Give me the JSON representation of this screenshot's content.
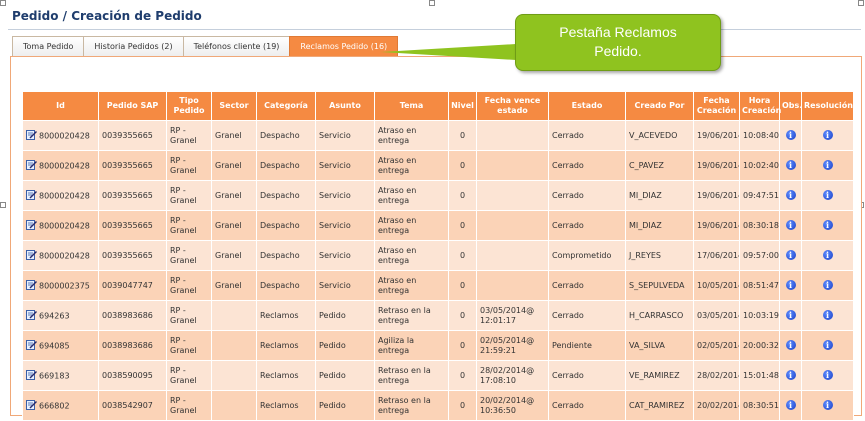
{
  "page": {
    "title": "Pedido / Creación de Pedido"
  },
  "tabs": [
    {
      "label": "Toma Pedido",
      "active": false
    },
    {
      "label": "Historia Pedidos (2)",
      "active": false
    },
    {
      "label": "Teléfonos cliente (19)",
      "active": false
    },
    {
      "label": "Reclamos Pedido (16)",
      "active": true
    }
  ],
  "callout": {
    "line1": "Pestaña Reclamos",
    "line2": "Pedido."
  },
  "table": {
    "headers": [
      "Id",
      "Pedido SAP",
      "Tipo Pedido",
      "Sector",
      "Categoría",
      "Asunto",
      "Tema",
      "Nivel",
      "Fecha vence estado",
      "Estado",
      "Creado Por",
      "Fecha Creación",
      "Hora Creación",
      "Obs.",
      "Resolución"
    ],
    "rows": [
      {
        "id": "8000020428",
        "pedido_sap": "0039355665",
        "tipo": "RP - Granel",
        "sector": "Granel",
        "categoria": "Despacho",
        "asunto": "Servicio",
        "tema": "Atraso en entrega",
        "nivel": "0",
        "fecha_vence": "",
        "estado": "Cerrado",
        "creado_por": "V_ACEVEDO",
        "fecha": "19/06/2014",
        "hora": "10:08:40"
      },
      {
        "id": "8000020428",
        "pedido_sap": "0039355665",
        "tipo": "RP - Granel",
        "sector": "Granel",
        "categoria": "Despacho",
        "asunto": "Servicio",
        "tema": "Atraso en entrega",
        "nivel": "0",
        "fecha_vence": "",
        "estado": "Cerrado",
        "creado_por": "C_PAVEZ",
        "fecha": "19/06/2014",
        "hora": "10:02:40"
      },
      {
        "id": "8000020428",
        "pedido_sap": "0039355665",
        "tipo": "RP - Granel",
        "sector": "Granel",
        "categoria": "Despacho",
        "asunto": "Servicio",
        "tema": "Atraso en entrega",
        "nivel": "0",
        "fecha_vence": "",
        "estado": "Cerrado",
        "creado_por": "MI_DIAZ",
        "fecha": "19/06/2014",
        "hora": "09:47:51"
      },
      {
        "id": "8000020428",
        "pedido_sap": "0039355665",
        "tipo": "RP - Granel",
        "sector": "Granel",
        "categoria": "Despacho",
        "asunto": "Servicio",
        "tema": "Atraso en entrega",
        "nivel": "0",
        "fecha_vence": "",
        "estado": "Cerrado",
        "creado_por": "MI_DIAZ",
        "fecha": "19/06/2014",
        "hora": "08:30:18"
      },
      {
        "id": "8000020428",
        "pedido_sap": "0039355665",
        "tipo": "RP - Granel",
        "sector": "Granel",
        "categoria": "Despacho",
        "asunto": "Servicio",
        "tema": "Atraso en entrega",
        "nivel": "0",
        "fecha_vence": "",
        "estado": "Comprometido",
        "creado_por": "J_REYES",
        "fecha": "17/06/2014",
        "hora": "09:57:00"
      },
      {
        "id": "8000002375",
        "pedido_sap": "0039047747",
        "tipo": "RP - Granel",
        "sector": "Granel",
        "categoria": "Despacho",
        "asunto": "Servicio",
        "tema": "Atraso en entrega",
        "nivel": "0",
        "fecha_vence": "",
        "estado": "Cerrado",
        "creado_por": "S_SEPULVEDA",
        "fecha": "10/05/2014",
        "hora": "08:51:47"
      },
      {
        "id": "694263",
        "pedido_sap": "0038983686",
        "tipo": "RP - Granel",
        "sector": "",
        "categoria": "Reclamos",
        "asunto": "Pedido",
        "tema": "Retraso en la entrega",
        "nivel": "0",
        "fecha_vence": "03/05/2014@ 12:01:17",
        "estado": "Cerrado",
        "creado_por": "H_CARRASCO",
        "fecha": "03/05/2014",
        "hora": "10:03:19"
      },
      {
        "id": "694085",
        "pedido_sap": "0038983686",
        "tipo": "RP - Granel",
        "sector": "",
        "categoria": "Reclamos",
        "asunto": "Pedido",
        "tema": "Agiliza la entrega",
        "nivel": "0",
        "fecha_vence": "02/05/2014@ 21:59:21",
        "estado": "Pendiente",
        "creado_por": "VA_SILVA",
        "fecha": "02/05/2014",
        "hora": "20:00:32"
      },
      {
        "id": "669183",
        "pedido_sap": "0038590095",
        "tipo": "RP - Granel",
        "sector": "",
        "categoria": "Reclamos",
        "asunto": "Pedido",
        "tema": "Retraso en la entrega",
        "nivel": "0",
        "fecha_vence": "28/02/2014@ 17:08:10",
        "estado": "Cerrado",
        "creado_por": "VE_RAMIREZ",
        "fecha": "28/02/2014",
        "hora": "15:01:48"
      },
      {
        "id": "666802",
        "pedido_sap": "0038542907",
        "tipo": "RP - Granel",
        "sector": "",
        "categoria": "Reclamos",
        "asunto": "Pedido",
        "tema": "Retraso en la entrega",
        "nivel": "0",
        "fecha_vence": "20/02/2014@ 10:36:50",
        "estado": "Cerrado",
        "creado_por": "CAT_RAMIREZ",
        "fecha": "20/02/2014",
        "hora": "08:30:51"
      }
    ]
  },
  "colors": {
    "accent": "#f58a42",
    "row_light": "#fce4d4",
    "row_dark": "#fbd3b7",
    "callout": "#8fc31f",
    "title": "#1f3d6d",
    "info_icon": "#1a3fc6"
  },
  "icons": {
    "row": "edit-record-icon",
    "obs": "info-icon",
    "resolucion": "info-icon"
  }
}
